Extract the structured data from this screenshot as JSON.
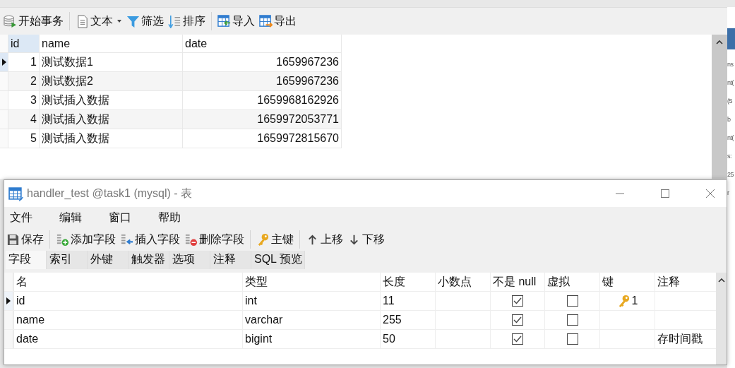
{
  "back_window": {
    "toolbar": [
      {
        "kind": "db",
        "label": "开始事务"
      },
      {
        "kind": "doc",
        "label": "文本",
        "dropdown": true
      },
      {
        "kind": "filter",
        "label": "筛选"
      },
      {
        "kind": "sort",
        "label": "排序"
      },
      {
        "kind": "import",
        "label": "导入"
      },
      {
        "kind": "export",
        "label": "导出"
      }
    ],
    "table": {
      "columns": [
        "id",
        "name",
        "date"
      ],
      "rows": [
        {
          "selected": true,
          "cells": [
            "1",
            "测试数据1",
            "1659967236"
          ]
        },
        {
          "selected": false,
          "cells": [
            "2",
            "测试数据2",
            "1659967236"
          ]
        },
        {
          "selected": false,
          "cells": [
            "3",
            "测试插入数据",
            "1659968162926"
          ]
        },
        {
          "selected": false,
          "cells": [
            "4",
            "测试插入数据",
            "1659972053771"
          ]
        },
        {
          "selected": false,
          "cells": [
            "5",
            "测试插入数据",
            "1659972815670"
          ]
        }
      ]
    }
  },
  "side_window": {
    "fragments": [
      "ns",
      "nt(",
      "(5",
      "b",
      "nt(",
      "s:",
      "25",
      "r"
    ]
  },
  "window": {
    "title": "handler_test @task1 (mysql) - 表",
    "menu": [
      "文件",
      "编辑",
      "窗口",
      "帮助"
    ],
    "toolbar": [
      {
        "kind": "save",
        "label": "保存"
      },
      {
        "kind": "add",
        "label": "添加字段"
      },
      {
        "kind": "insert",
        "label": "插入字段"
      },
      {
        "kind": "delete",
        "label": "删除字段"
      },
      {
        "kind": "key",
        "label": "主键"
      },
      {
        "kind": "up",
        "label": "上移"
      },
      {
        "kind": "down",
        "label": "下移"
      }
    ],
    "tabs": [
      {
        "label": "字段",
        "selected": true
      },
      {
        "label": "索引",
        "selected": false
      },
      {
        "label": "外键",
        "selected": false
      },
      {
        "label": "触发器",
        "selected": false
      },
      {
        "label": "选项",
        "selected": false
      },
      {
        "label": "注释",
        "selected": false
      },
      {
        "label": "SQL 预览",
        "selected": false
      }
    ],
    "fields": {
      "columns": [
        "名",
        "类型",
        "长度",
        "小数点",
        "不是 null",
        "虚拟",
        "键",
        "注释"
      ],
      "rows": [
        {
          "selected": true,
          "name": "id",
          "type": "int",
          "length": "11",
          "not_null": true,
          "virtual": false,
          "key": "1",
          "comment": ""
        },
        {
          "selected": false,
          "name": "name",
          "type": "varchar",
          "length": "255",
          "not_null": true,
          "virtual": false,
          "key": "",
          "comment": ""
        },
        {
          "selected": false,
          "name": "date",
          "type": "bigint",
          "length": "50",
          "not_null": true,
          "virtual": false,
          "key": "",
          "comment": "存时间戳"
        }
      ]
    }
  }
}
